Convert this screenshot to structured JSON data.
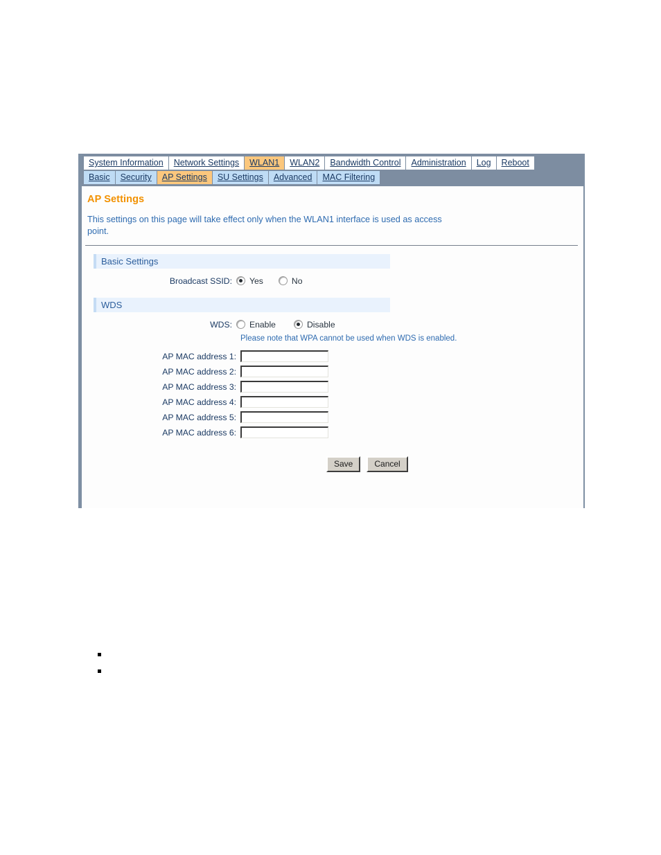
{
  "window": {
    "main_tabs": [
      {
        "label": "System Information",
        "active": false
      },
      {
        "label": "Network Settings",
        "active": false
      },
      {
        "label": "WLAN1",
        "active": true
      },
      {
        "label": "WLAN2",
        "active": false
      },
      {
        "label": "Bandwidth Control",
        "active": false
      },
      {
        "label": "Administration",
        "active": false
      },
      {
        "label": "Log",
        "active": false
      },
      {
        "label": "Reboot",
        "active": false
      }
    ],
    "sub_tabs": [
      {
        "label": "Basic",
        "active": false
      },
      {
        "label": "Security",
        "active": false
      },
      {
        "label": "AP Settings",
        "active": true
      },
      {
        "label": "SU Settings",
        "active": false
      },
      {
        "label": "Advanced",
        "active": false
      },
      {
        "label": "MAC Filtering",
        "active": false
      }
    ]
  },
  "page": {
    "title": "AP Settings",
    "description": "This settings on this page will take effect only when the WLAN1 interface is used as access point."
  },
  "basic_settings": {
    "heading": "Basic Settings",
    "broadcast_ssid": {
      "label": "Broadcast SSID:",
      "options": [
        {
          "label": "Yes",
          "checked": true
        },
        {
          "label": "No",
          "checked": false
        }
      ]
    }
  },
  "wds": {
    "heading": "WDS",
    "wds_mode": {
      "label": "WDS:",
      "options": [
        {
          "label": "Enable",
          "checked": false
        },
        {
          "label": "Disable",
          "checked": true
        }
      ]
    },
    "note": "Please note that WPA cannot be used when WDS is enabled.",
    "mac_addresses": [
      {
        "label": "AP MAC address 1:",
        "value": ""
      },
      {
        "label": "AP MAC address 2:",
        "value": ""
      },
      {
        "label": "AP MAC address 3:",
        "value": ""
      },
      {
        "label": "AP MAC address 4:",
        "value": ""
      },
      {
        "label": "AP MAC address 5:",
        "value": ""
      },
      {
        "label": "AP MAC address 6:",
        "value": ""
      }
    ]
  },
  "buttons": {
    "save": "Save",
    "cancel": "Cancel"
  },
  "bullets": [
    {
      "text": ""
    },
    {
      "text": ""
    }
  ],
  "colors": {
    "accent_orange": "#f29100",
    "tab_active": "#fbc77d",
    "tab_inactive": "#ffffff",
    "subtab_inactive": "#bfdcf5",
    "tabbar_bg": "#7d8da1",
    "link_blue": "#1b3a63",
    "text_blue": "#2e6bb0",
    "section_bg": "#e9f2fd",
    "frame_border": "#7e8fa3",
    "button_face": "#d4d0c8"
  }
}
